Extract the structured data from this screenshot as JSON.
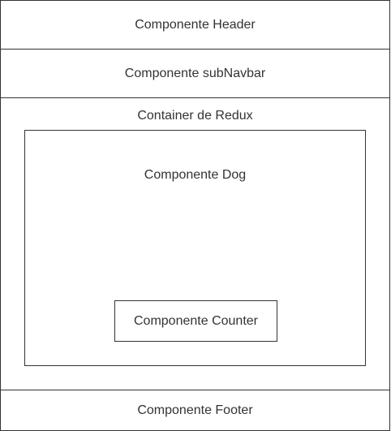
{
  "diagram": {
    "header": {
      "label": "Componente Header"
    },
    "subnavbar": {
      "label": "Componente subNavbar"
    },
    "redux_container": {
      "label": "Container de Redux"
    },
    "dog": {
      "label": "Componente Dog"
    },
    "counter": {
      "label": "Componente Counter"
    },
    "footer": {
      "label": "Componente Footer"
    }
  },
  "colors": {
    "stroke": "#333333",
    "fill": "#ffffff",
    "text": "#333333"
  }
}
